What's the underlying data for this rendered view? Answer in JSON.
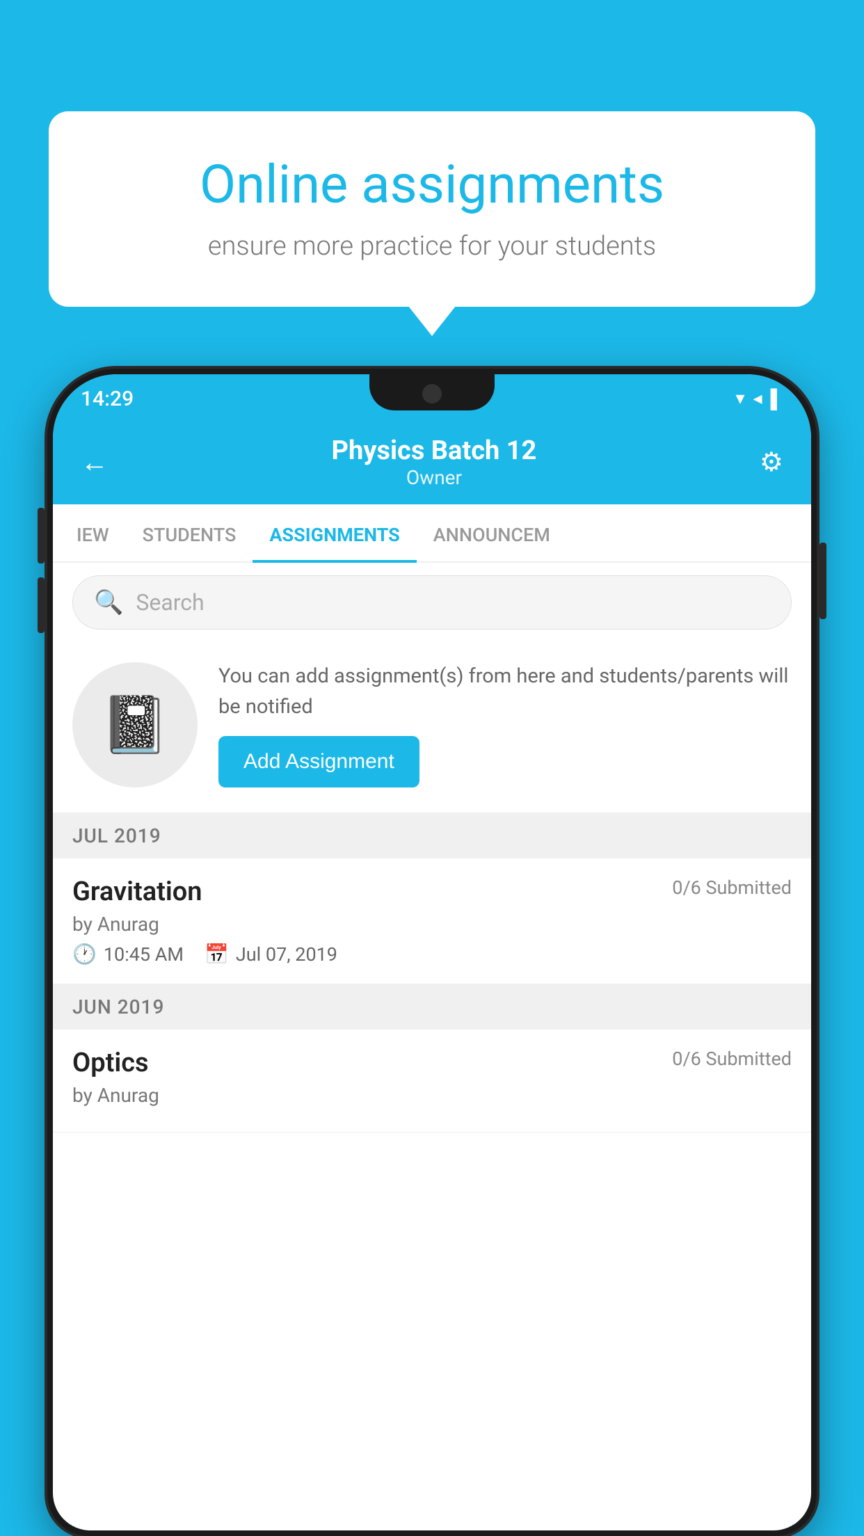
{
  "background_color": "#1cb8e8",
  "speech_bubble": {
    "title": "Online assignments",
    "subtitle": "ensure more practice for your students"
  },
  "phone": {
    "status_bar": {
      "time": "14:29"
    },
    "header": {
      "back_label": "←",
      "title": "Physics Batch 12",
      "subtitle": "Owner",
      "settings_label": "⚙"
    },
    "tabs": [
      {
        "label": "IEW",
        "active": false
      },
      {
        "label": "STUDENTS",
        "active": false
      },
      {
        "label": "ASSIGNMENTS",
        "active": true
      },
      {
        "label": "ANNOUNCEM",
        "active": false
      }
    ],
    "search": {
      "placeholder": "Search"
    },
    "promo": {
      "icon": "📓",
      "description": "You can add assignment(s) from here and students/parents will be notified",
      "button_label": "Add Assignment"
    },
    "sections": [
      {
        "month_label": "JUL 2019",
        "assignments": [
          {
            "title": "Gravitation",
            "submitted": "0/6 Submitted",
            "by": "by Anurag",
            "time": "10:45 AM",
            "date": "Jul 07, 2019"
          }
        ]
      },
      {
        "month_label": "JUN 2019",
        "assignments": [
          {
            "title": "Optics",
            "submitted": "0/6 Submitted",
            "by": "by Anurag",
            "time": "",
            "date": ""
          }
        ]
      }
    ]
  }
}
